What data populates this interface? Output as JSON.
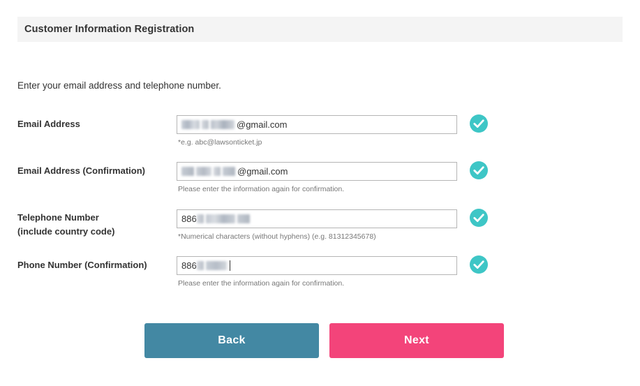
{
  "header": {
    "title": "Customer Information Registration",
    "background_color": "#f4f4f4"
  },
  "intro": {
    "text": "Enter your email address and telephone number."
  },
  "form": {
    "fields": [
      {
        "label": "Email Address",
        "label_line2": "",
        "value_visible_suffix": "@gmail.com",
        "value_redacted": true,
        "hint": "*e.g. abc@lawsonticket.jp",
        "status": "valid",
        "status_icon": "check-circle-icon"
      },
      {
        "label": "Email Address (Confirmation)",
        "label_line2": "",
        "value_visible_suffix": "@gmail.com",
        "value_redacted": true,
        "hint": "Please enter the information again for confirmation.",
        "status": "valid",
        "status_icon": "check-circle-icon"
      },
      {
        "label": "Telephone Number",
        "label_line2": "(include country code)",
        "value_visible_prefix": "886",
        "value_redacted": true,
        "hint": "*Numerical characters (without hyphens) (e.g. 81312345678)",
        "status": "valid",
        "status_icon": "check-circle-icon"
      },
      {
        "label": "Phone Number (Confirmation)",
        "label_line2": "",
        "value_visible_prefix": "886",
        "value_redacted": true,
        "has_caret": true,
        "hint": "Please enter the information again for confirmation.",
        "status": "valid",
        "status_icon": "check-circle-icon"
      }
    ]
  },
  "buttons": {
    "back_label": "Back",
    "next_label": "Next",
    "back_color": "#4388a3",
    "next_color": "#f3447a"
  },
  "colors": {
    "check_icon": "#3ec6c6",
    "text": "#333333",
    "hint": "#777777",
    "input_border": "#b5b5b5"
  }
}
